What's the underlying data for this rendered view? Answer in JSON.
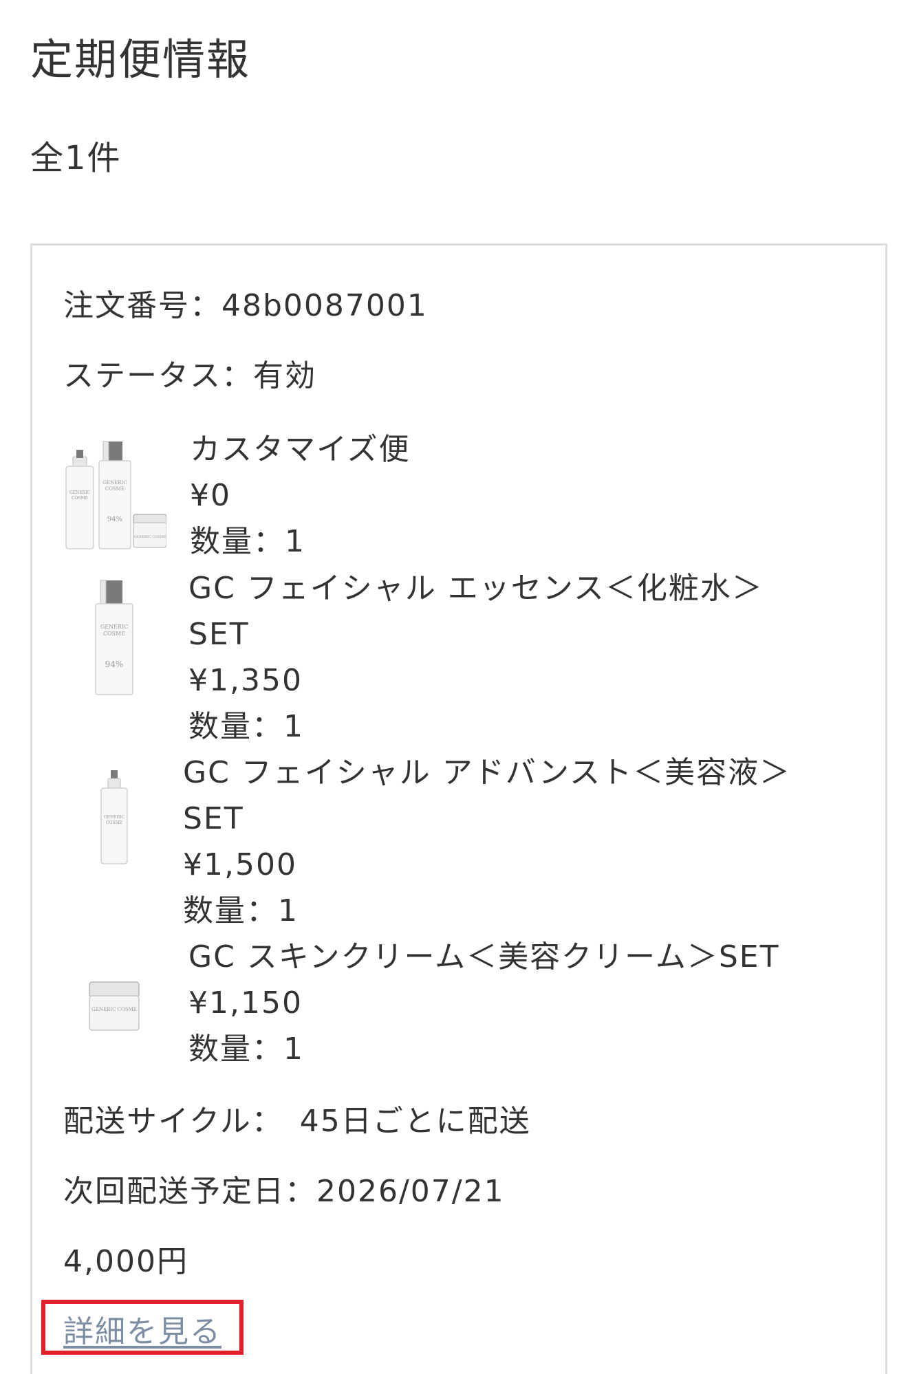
{
  "page": {
    "title": "定期便情報",
    "count": "全1件"
  },
  "order": {
    "number_line": "注文番号：48b0087001",
    "status_line": "ステータス：有効",
    "items": [
      {
        "name_lines": [
          "カスタマイズ便"
        ],
        "price": "¥0",
        "quantity": "数量：1",
        "image": "product-set-image"
      },
      {
        "name_lines": [
          "GC フェイシャル エッセンス＜化粧水＞",
          "SET"
        ],
        "price": "¥1,350",
        "quantity": "数量：1",
        "image": "lotion-bottle-image"
      },
      {
        "name_lines": [
          "GC フェイシャル アドバンスト＜美容液＞",
          "SET"
        ],
        "price": "¥1,500",
        "quantity": "数量：1",
        "image": "serum-bottle-image"
      },
      {
        "name_lines": [
          "GC スキンクリーム＜美容クリーム＞SET"
        ],
        "price": "¥1,150",
        "quantity": "数量：1",
        "image": "cream-jar-image"
      }
    ],
    "cycle_line": "配送サイクル：　45日ごとに配送",
    "next_delivery_line": "次回配送予定日：2026/07/21",
    "total": "4,000円",
    "details_link": "詳細を見る"
  },
  "colors": {
    "text": "#333333",
    "link": "#7d8da3",
    "highlight_border": "#e1202a",
    "card_border": "#dddddd"
  },
  "product_label": {
    "brand_line1": "GENERIC",
    "brand_line2": "COSME",
    "brand_full": "GENERIC COSME",
    "badge": "94%"
  }
}
